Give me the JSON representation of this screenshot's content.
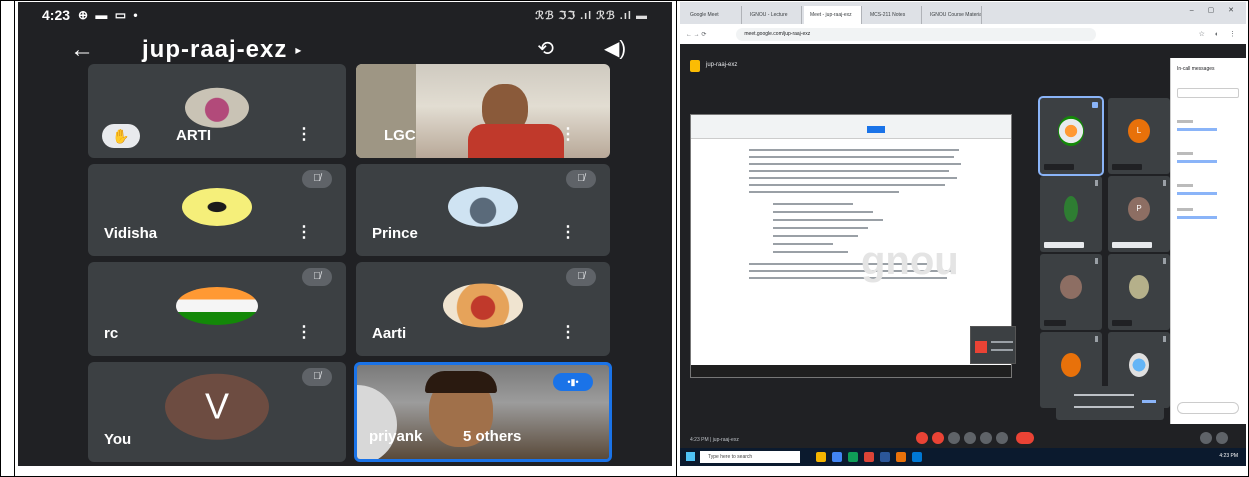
{
  "phone": {
    "status_time": "4:23",
    "status_icons": "⊕ ▬ ▭ •",
    "status_right": "ℛℬ ℑℑ .ıl ℛℬ .ıl ▬",
    "meeting_code": "jup-raaj-exz",
    "code_chevron": "▸",
    "back_icon": "←",
    "camera_flip_icon": "⟲",
    "speaker_icon": "◀)",
    "menu_glyph": "⋮",
    "mute_glyph": "🎙̸",
    "hand_glyph": "✋",
    "participants": [
      {
        "name": "ARTI",
        "hand_raised": true
      },
      {
        "name": "LGC"
      },
      {
        "name": "Vidisha"
      },
      {
        "name": "Prince"
      },
      {
        "name": "rc"
      },
      {
        "name": "Aarti"
      },
      {
        "name": "You",
        "initial": "V"
      },
      {
        "name": "priyank",
        "overflow": "5 others"
      }
    ],
    "speaking_glyph": "•▮•",
    "colors": {
      "bg": "#202124",
      "tile": "#3c4043",
      "accent": "#1a73e8"
    }
  },
  "desktop": {
    "tabs": [
      "Google Meet",
      "IGNOU - Lecture",
      "Meet - jup-raaj-exz",
      "MCS-211 Notes",
      "IGNOU Course Material"
    ],
    "address": "meet.google.com/jup-raaj-exz",
    "meet_title": "jup-raaj-exz",
    "side_panel_title": "In-call messages",
    "meeting_label": "4:23 PM | jup-raaj-exz",
    "taskbar_search": "Type here to search",
    "clock": "4:23 PM",
    "tile_initials": [
      "",
      "L",
      "",
      "P",
      "",
      "",
      "",
      ""
    ]
  }
}
